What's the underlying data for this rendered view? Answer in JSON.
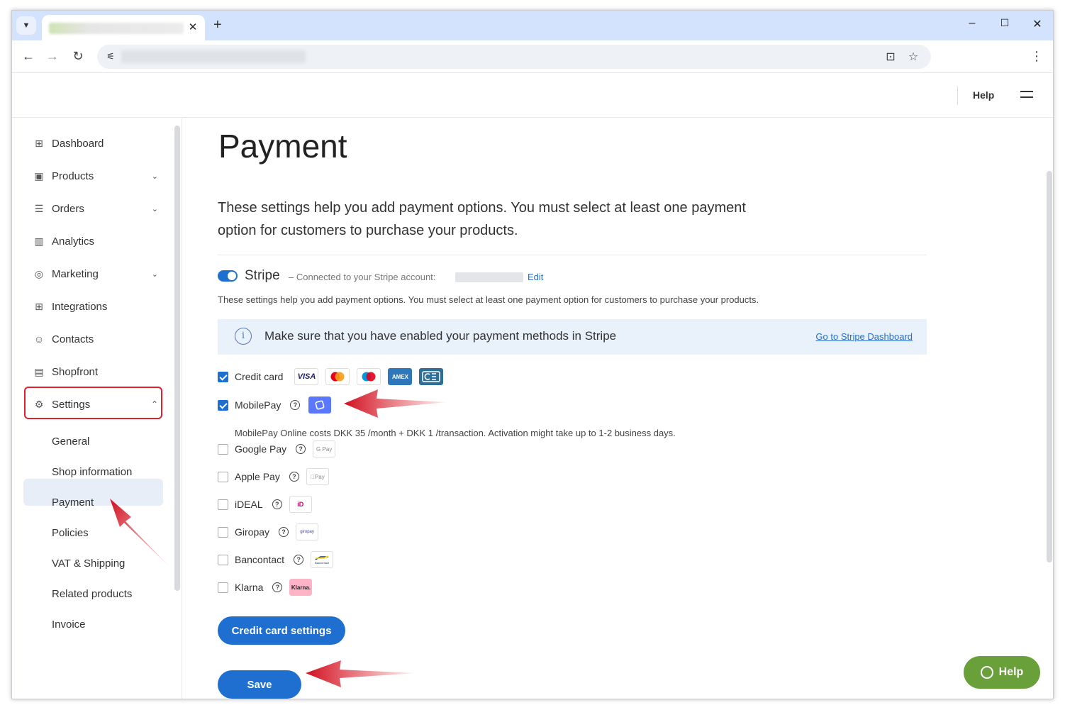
{
  "browser": {
    "new_tab": "+",
    "tab_close": "✕",
    "minimize": "–",
    "maximize": "☐",
    "close": "✕"
  },
  "header": {
    "help_label": "Help"
  },
  "sidebar": {
    "items": [
      {
        "label": "Dashboard",
        "icon": "dashboard-icon",
        "glyph": "⊞"
      },
      {
        "label": "Products",
        "icon": "products-icon",
        "glyph": "▣"
      },
      {
        "label": "Orders",
        "icon": "orders-icon",
        "glyph": "☰"
      },
      {
        "label": "Analytics",
        "icon": "analytics-icon",
        "glyph": "▥"
      },
      {
        "label": "Marketing",
        "icon": "marketing-icon",
        "glyph": "◎"
      },
      {
        "label": "Integrations",
        "icon": "integrations-icon",
        "glyph": "⊞"
      },
      {
        "label": "Contacts",
        "icon": "contacts-icon",
        "glyph": "☺"
      },
      {
        "label": "Shopfront",
        "icon": "shopfront-icon",
        "glyph": "▤"
      },
      {
        "label": "Settings",
        "icon": "settings-icon",
        "glyph": "⚙"
      }
    ],
    "settings_sub": [
      "General",
      "Shop information",
      "Payment",
      "Policies",
      "VAT & Shipping",
      "Related products",
      "Invoice"
    ]
  },
  "main": {
    "title": "Payment",
    "intro": "These settings help you add payment options. You must select at least one payment option for customers to purchase your products.",
    "stripe": {
      "name": "Stripe",
      "connected_text": "– Connected to your Stripe account:",
      "edit_label": "Edit",
      "description": "These settings help you add payment options. You must select at least one payment option for customers to purchase your products."
    },
    "info": {
      "icon_glyph": "i",
      "text": "Make sure that you have enabled your payment methods in Stripe",
      "link": "Go to Stripe Dashboard"
    },
    "methods": [
      {
        "label": "Credit card",
        "checked": true
      },
      {
        "label": "MobilePay",
        "checked": true
      },
      {
        "label": "Google Pay",
        "checked": false,
        "logo": "G Pay"
      },
      {
        "label": "Apple Pay",
        "checked": false,
        "logo": "Pay"
      },
      {
        "label": "iDEAL",
        "checked": false,
        "logo": "iD"
      },
      {
        "label": "Giropay",
        "checked": false,
        "logo": "giropay"
      },
      {
        "label": "Bancontact",
        "checked": false,
        "logo": "Bancontact"
      },
      {
        "label": "Klarna",
        "checked": false,
        "logo": "Klarna."
      }
    ],
    "card_logos": [
      "VISA",
      "AMEX"
    ],
    "mobilepay_note": "MobilePay Online costs DKK 35 /month + DKK 1 /transaction. Activation might take up to 1-2 business days.",
    "credit_card_settings_label": "Credit card settings",
    "save_label": "Save"
  },
  "help_float": {
    "label": "Help"
  },
  "colors": {
    "primary": "#1e6fd0",
    "help_green": "#6aa03a",
    "highlight_red": "#e0202d"
  }
}
